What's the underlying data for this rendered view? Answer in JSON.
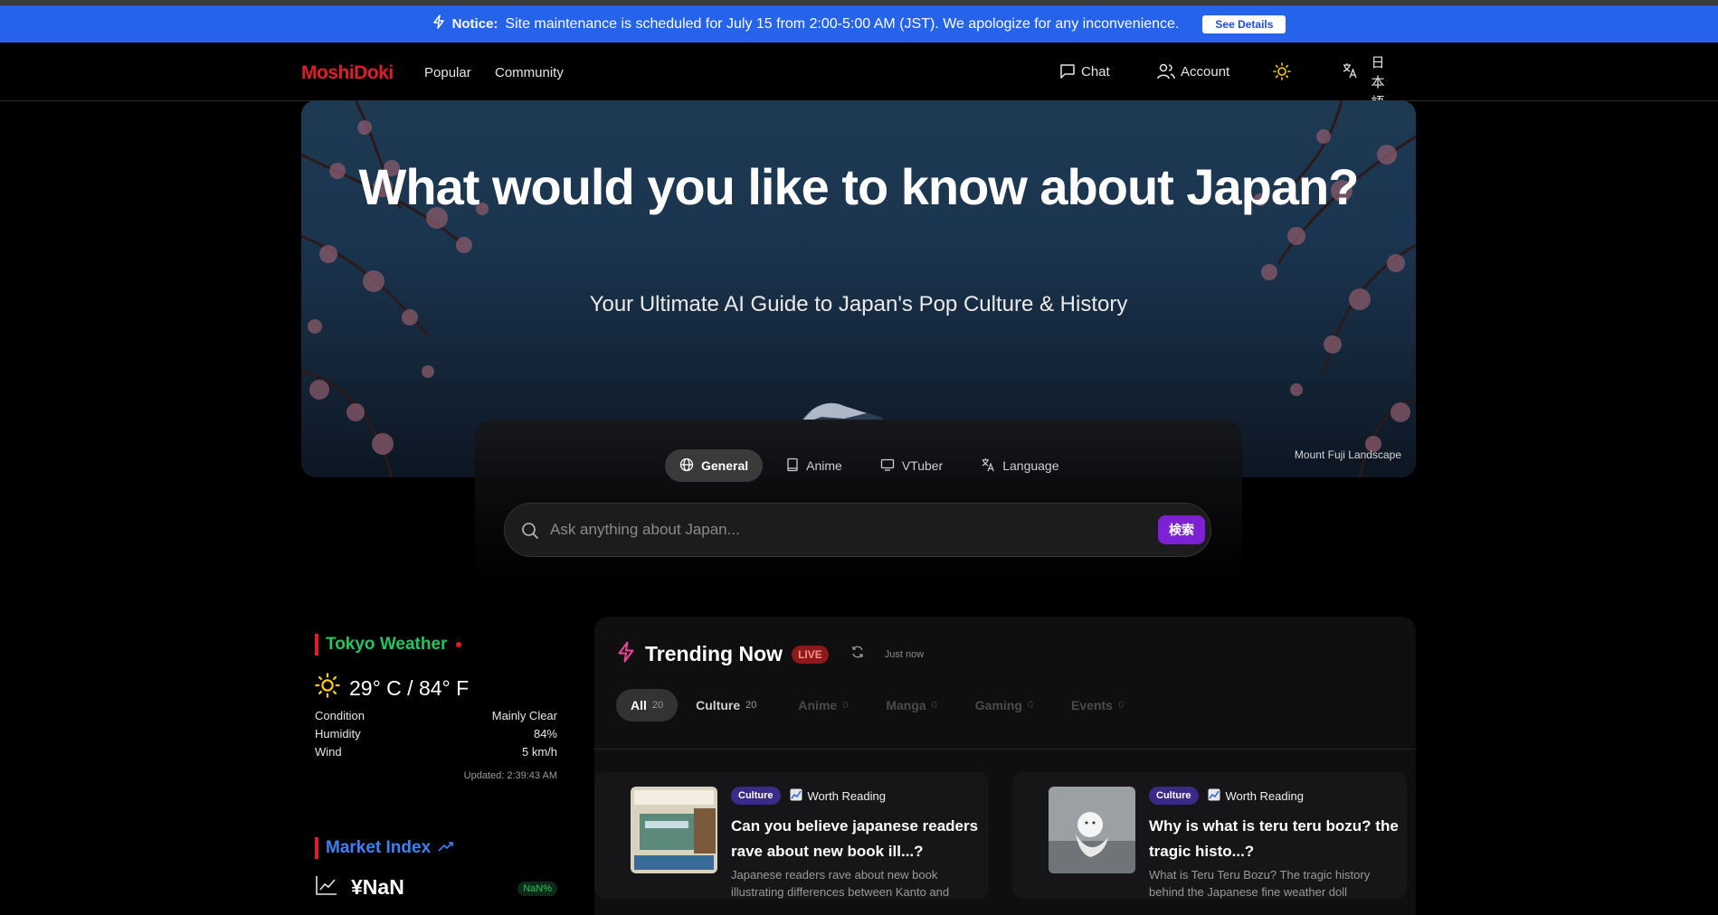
{
  "notice": {
    "label": "Notice:",
    "text": "Site maintenance is scheduled for July 15 from 2:00-5:00 AM (JST). We apologize for any inconvenience.",
    "button": "See Details"
  },
  "nav": {
    "logo": "MoshiDoki",
    "links": [
      "Popular",
      "Community"
    ],
    "chat": "Chat",
    "account": "Account",
    "language": "日本語"
  },
  "hero": {
    "title": "What would you like to know about Japan?",
    "subtitle": "Your Ultimate AI Guide to Japan's Pop Culture & History",
    "caption": "Mount Fuji Landscape"
  },
  "search": {
    "tabs": [
      "General",
      "Anime",
      "VTuber",
      "Language"
    ],
    "active_tab": "General",
    "placeholder": "Ask anything about Japan...",
    "button": "検索"
  },
  "weather": {
    "title": "Tokyo Weather",
    "temperature": "29° C / 84° F",
    "rows": [
      {
        "label": "Condition",
        "value": "Mainly Clear"
      },
      {
        "label": "Humidity",
        "value": "84%"
      },
      {
        "label": "Wind",
        "value": "5 km/h"
      }
    ],
    "updated": "Updated: 2:39:43 AM"
  },
  "market": {
    "title": "Market Index",
    "value": "¥NaN",
    "change": "NaN%"
  },
  "trending": {
    "title": "Trending Now",
    "live": "LIVE",
    "updated": "Just now",
    "filters": [
      {
        "label": "All",
        "count": "20"
      },
      {
        "label": "Culture",
        "count": "20"
      },
      {
        "label": "Anime",
        "count": "0"
      },
      {
        "label": "Manga",
        "count": "0"
      },
      {
        "label": "Gaming",
        "count": "0"
      },
      {
        "label": "Events",
        "count": "0"
      }
    ],
    "cards": [
      {
        "category": "Culture",
        "tag": "Worth Reading",
        "title": "Can you believe japanese readers rave about new book ill...?",
        "description": "Japanese readers rave about new book illustrating differences between Kanto and"
      },
      {
        "category": "Culture",
        "tag": "Worth Reading",
        "title": "Why is what is teru teru bozu? the tragic histo...?",
        "description": "What is Teru Teru Bozu? The tragic history behind the Japanese fine weather doll"
      }
    ]
  },
  "colors": {
    "notice_bg": "#2563eb",
    "logo": "#e11d2a",
    "weather_title": "#22c55e",
    "market_title": "#3b82f6",
    "search_button": "#7c22d4",
    "live_badge": "#8b1a1a"
  }
}
